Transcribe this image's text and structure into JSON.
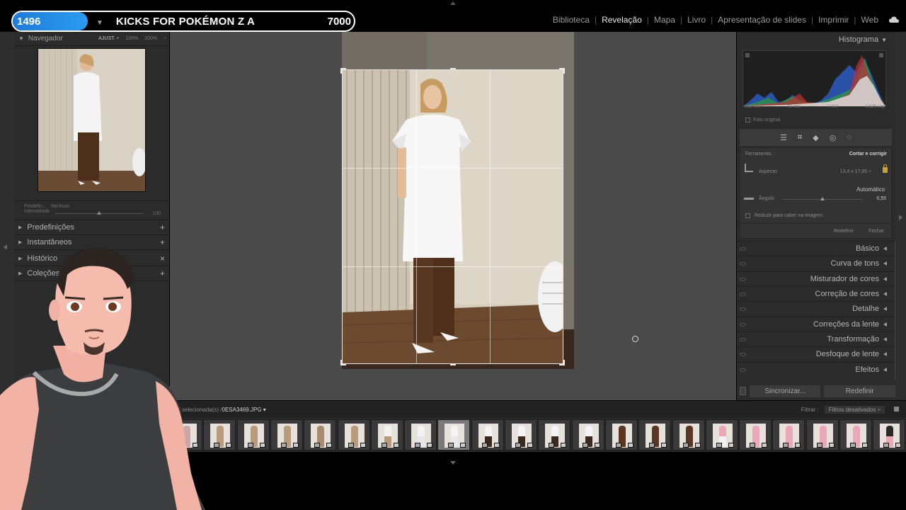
{
  "overlay": {
    "counter": "1496",
    "title": "KICKS FOR POKÉMON Z A",
    "value": "7000"
  },
  "modules": [
    "Biblioteca",
    "Revelação",
    "Mapa",
    "Livro",
    "Apresentação de slides",
    "Imprimir",
    "Web"
  ],
  "active_module": "Revelação",
  "navigator": {
    "title": "Navegador",
    "zoom_fit": "AJUST. ÷",
    "zoom_100": "100%",
    "zoom_200": "200%",
    "zoom_more": "÷"
  },
  "preset_box": {
    "preset_label": "Predefin.:",
    "preset_value": "Nenhum",
    "intensity_label": "Intensidade",
    "intensity_value": "100"
  },
  "left_sections": [
    {
      "label": "Predefinições",
      "action": "+"
    },
    {
      "label": "Instantâneos",
      "action": "+"
    },
    {
      "label": "Histórico",
      "action": "×"
    },
    {
      "label": "Coleções",
      "action": "+"
    }
  ],
  "histogram": {
    "title": "Histograma",
    "iso": "ISO 500",
    "focal": "50 mm",
    "aperture": "f / 8,0",
    "shutter": "1/125 seg",
    "original_photo": "Foto original"
  },
  "tool_icons": [
    "sliders-icon",
    "crop-tool-icon",
    "healing-icon",
    "red-eye-icon",
    "mask-icon"
  ],
  "crop_panel": {
    "tool_label": "Ferramenta :",
    "tool_value": "Cortar e corrigir",
    "aspect_label": "Aspecto:",
    "aspect_value": "13,4 x 17,85 ÷",
    "auto_label": "Automático",
    "angle_label": "Ângulo",
    "angle_value": "0,55",
    "constrain_label": "Reduzir para caber na imagem",
    "reset_label": "Redefinir",
    "close_label": "Fechar"
  },
  "right_sections": [
    "Básico",
    "Curva de tons",
    "Misturador de cores",
    "Correção de cores",
    "Detalhe",
    "Correções da lente",
    "Transformação",
    "Desfoque de lente",
    "Efeitos"
  ],
  "sync": {
    "sync_label": "Sincronizar...",
    "reset_label": "Redefinir"
  },
  "filmstrip": {
    "selection_info": "/ 177 selecionada(s) /",
    "filename": "0ESA3469.JPG ▾",
    "filter_label": "Filtrar :",
    "filter_value": "Filtros desativados ÷"
  },
  "colors": {
    "accent_blue": "#2a8be6",
    "panel_bg": "#2b2b2b",
    "canvas_bg": "#4a4a4a",
    "lock_gold": "#c8a53a"
  }
}
